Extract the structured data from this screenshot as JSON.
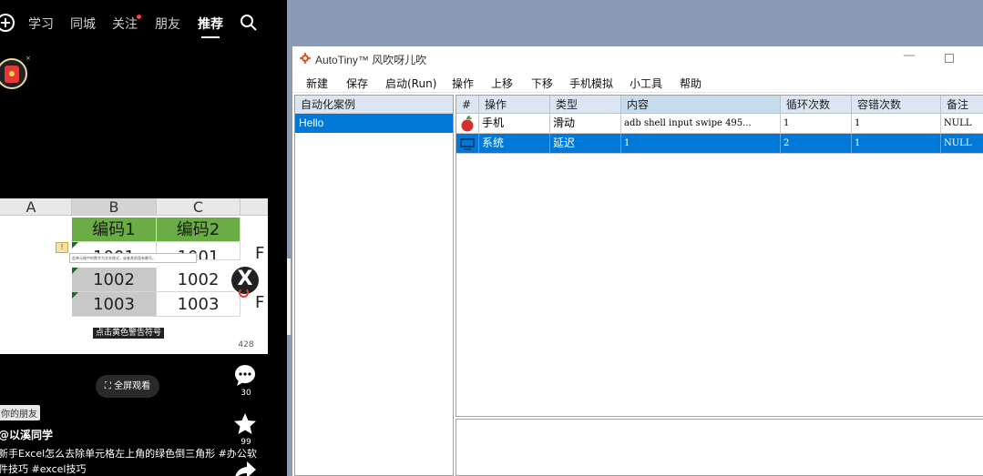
{
  "phone": {
    "nav": [
      "学习",
      "同城",
      "关注",
      "朋友",
      "推荐"
    ],
    "active_nav": "推荐",
    "video": {
      "columns": [
        "A",
        "B",
        "C"
      ],
      "header_row": [
        "编码1",
        "编码2"
      ],
      "rows": [
        [
          "1001",
          "1001"
        ],
        [
          "1002",
          "1002"
        ],
        [
          "1003",
          "1003"
        ]
      ],
      "f_col_letter": "F",
      "tooltip_text": "此单元格中的数字为文本格式，或者其前面有撇号。",
      "caption": "点击黄色警告符号"
    },
    "counts": {
      "likes": "428",
      "comments": "30",
      "favorites": "99"
    },
    "fullscreen_label": "全屏观看",
    "friend_tag": "你的朋友",
    "author": "@以溪同学",
    "description": "新手Excel怎么去除单元格左上角的绿色倒三角形 #办公软件技巧 #excel技巧"
  },
  "window": {
    "title": "AutoTiny™ 风吹呀儿吹",
    "menu": [
      "新建",
      "保存",
      "启动(Run)",
      "操作",
      "上移",
      "下移",
      "手机模拟",
      "小工具",
      "帮助"
    ],
    "left_header": "自动化案例",
    "left_items": [
      "Hello"
    ],
    "columns": [
      "#",
      "操作",
      "类型",
      "内容",
      "循环次数",
      "容错次数",
      "备注"
    ],
    "rows": [
      {
        "icon": "apple-icon",
        "op": "手机",
        "type": "滑动",
        "content": "adb shell input swipe 495...",
        "loops": "1",
        "tolerance": "1",
        "note": "NULL"
      },
      {
        "icon": "monitor-icon",
        "op": "系统",
        "type": "延迟",
        "content": "1",
        "loops": "2",
        "tolerance": "1",
        "note": "NULL"
      }
    ],
    "selected_row": 1,
    "colors": {
      "selection": "#0078d7",
      "header": "#dbe6f2"
    }
  }
}
